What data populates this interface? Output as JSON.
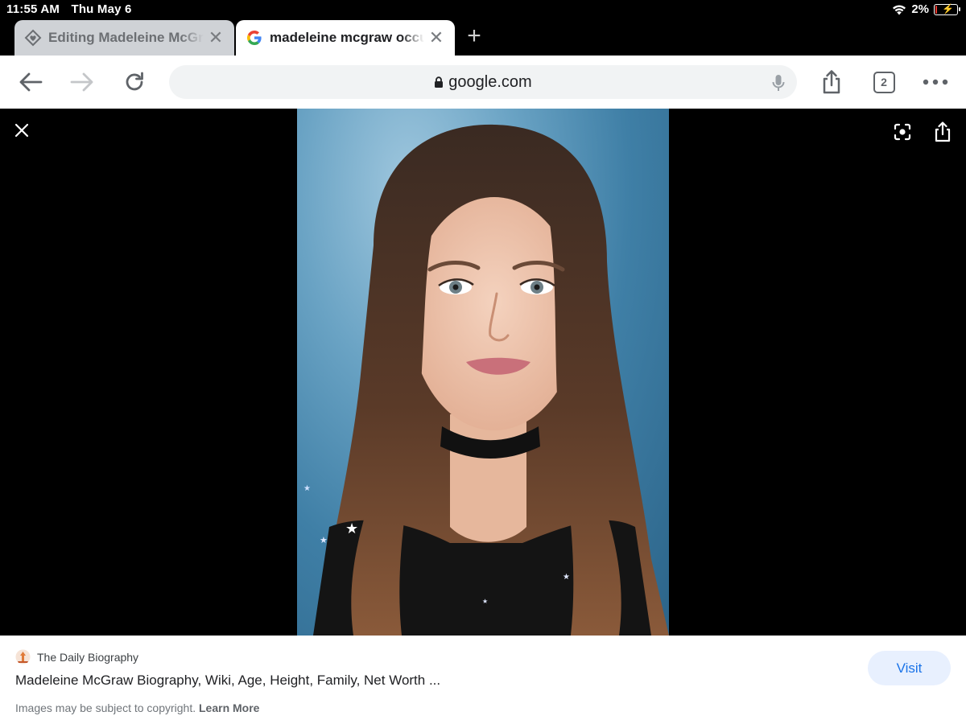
{
  "status_bar": {
    "time": "11:55 AM",
    "date": "Thu May 6",
    "battery_percent": "2%",
    "battery_level": 0.02
  },
  "tabs": [
    {
      "title": "Editing Madeleine McGraw",
      "icon": "diamond-heart-icon",
      "active": false
    },
    {
      "title": "madeleine mcgraw occupation",
      "icon": "google-g-icon",
      "active": true
    }
  ],
  "toolbar": {
    "url": "google.com",
    "tab_count": "2"
  },
  "image": {
    "description_icon": "portrait-photo"
  },
  "info": {
    "source_name": "The Daily Biography",
    "result_title": "Madeleine McGraw Biography, Wiki, Age, Height, Family, Net Worth ...",
    "copyright_text": "Images may be subject to copyright.",
    "learn_more": "Learn More",
    "visit_label": "Visit"
  },
  "colors": {
    "accent": "#1a73e8",
    "visit_bg": "#e8f0fe",
    "battery_low": "#e8392e"
  }
}
